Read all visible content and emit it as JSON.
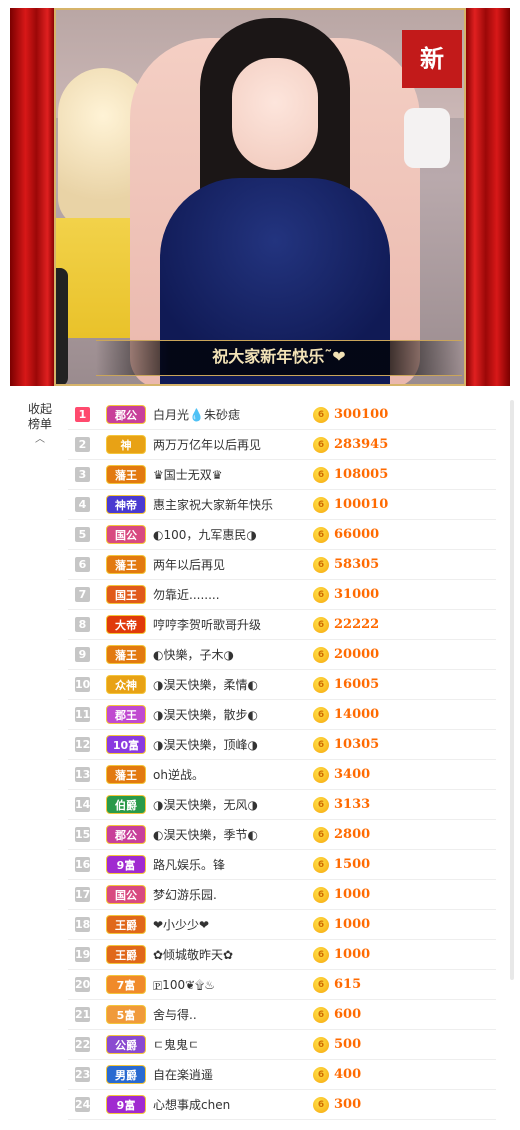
{
  "stream": {
    "caption": "祝大家新年快乐˜❤",
    "sign_text": "新"
  },
  "sidebar": {
    "collapse_label_1": "收起",
    "collapse_label_2": "榜单",
    "collapse_icon": "chevron-up-icon"
  },
  "coin_symbol": "6",
  "colors": {
    "value": "#ff6a00",
    "rank_first": "#ff4a6e",
    "rank_default": "#c6c6c6"
  },
  "ranking": [
    {
      "rank": "1",
      "badge": "郡公",
      "badge_color": "#c8409a",
      "name": "白月光💧朱砂痣",
      "value": "300100"
    },
    {
      "rank": "2",
      "badge": "神",
      "badge_color": "#e8a215",
      "name": "两万万亿年以后再见",
      "value": "283945"
    },
    {
      "rank": "3",
      "badge": "藩王",
      "badge_color": "#e27a10",
      "name": "♛国士无双♛",
      "value": "108005"
    },
    {
      "rank": "4",
      "badge": "神帝",
      "badge_color": "#4a3ad0",
      "name": "惠主家祝大家新年快乐",
      "value": "100010"
    },
    {
      "rank": "5",
      "badge": "国公",
      "badge_color": "#d84a80",
      "name": "◐100，九军惠民◑",
      "value": "66000"
    },
    {
      "rank": "6",
      "badge": "藩王",
      "badge_color": "#e27a10",
      "name": "两年以后再见",
      "value": "58305"
    },
    {
      "rank": "7",
      "badge": "国王",
      "badge_color": "#e05a1a",
      "name": "勿靠近........",
      "value": "31000"
    },
    {
      "rank": "8",
      "badge": "大帝",
      "badge_color": "#e03a0a",
      "name": "哼哼李贺听歌哥升级",
      "value": "22222"
    },
    {
      "rank": "9",
      "badge": "藩王",
      "badge_color": "#e27a10",
      "name": "◐快樂，子木◑",
      "value": "20000"
    },
    {
      "rank": "10",
      "badge": "众神",
      "badge_color": "#e8a215",
      "name": "◑淏天快樂，柔情◐",
      "value": "16005"
    },
    {
      "rank": "11",
      "badge": "郡王",
      "badge_color": "#c04ad0",
      "name": "◑淏天快樂，散步◐",
      "value": "14000"
    },
    {
      "rank": "12",
      "badge": "10富",
      "badge_color": "#8a3ae0",
      "name": "◑淏天快樂，顶峰◑",
      "value": "10305"
    },
    {
      "rank": "13",
      "badge": "藩王",
      "badge_color": "#e27a10",
      "name": "oh逆战。",
      "value": "3400"
    },
    {
      "rank": "14",
      "badge": "伯爵",
      "badge_color": "#2a9a4a",
      "name": "◑淏天快樂，无风◑",
      "value": "3133"
    },
    {
      "rank": "15",
      "badge": "郡公",
      "badge_color": "#c8409a",
      "name": "◐淏天快樂，季节◐",
      "value": "2800"
    },
    {
      "rank": "16",
      "badge": "9富",
      "badge_color": "#a02ad0",
      "name": "路凡娱乐。锋",
      "value": "1500"
    },
    {
      "rank": "17",
      "badge": "国公",
      "badge_color": "#d84a80",
      "name": "梦幻游乐园.",
      "value": "1000"
    },
    {
      "rank": "18",
      "badge": "王爵",
      "badge_color": "#e0681a",
      "name": "❤小少少❤",
      "value": "1000"
    },
    {
      "rank": "19",
      "badge": "王爵",
      "badge_color": "#e0681a",
      "name": "✿倾城敬昨天✿",
      "value": "1000"
    },
    {
      "rank": "20",
      "badge": "7富",
      "badge_color": "#f08a2a",
      "name": "🄿100❦۩♨",
      "value": "615"
    },
    {
      "rank": "21",
      "badge": "5富",
      "badge_color": "#f09a3a",
      "name": "舍与得..",
      "value": "600"
    },
    {
      "rank": "22",
      "badge": "公爵",
      "badge_color": "#8a4ad0",
      "name": "ㄷ鬼鬼ㄷ",
      "value": "500"
    },
    {
      "rank": "23",
      "badge": "男爵",
      "badge_color": "#2a6ad0",
      "name": "自在楽逍遥",
      "value": "400"
    },
    {
      "rank": "24",
      "badge": "9富",
      "badge_color": "#a02ad0",
      "name": "心想事成chen",
      "value": "300"
    }
  ]
}
